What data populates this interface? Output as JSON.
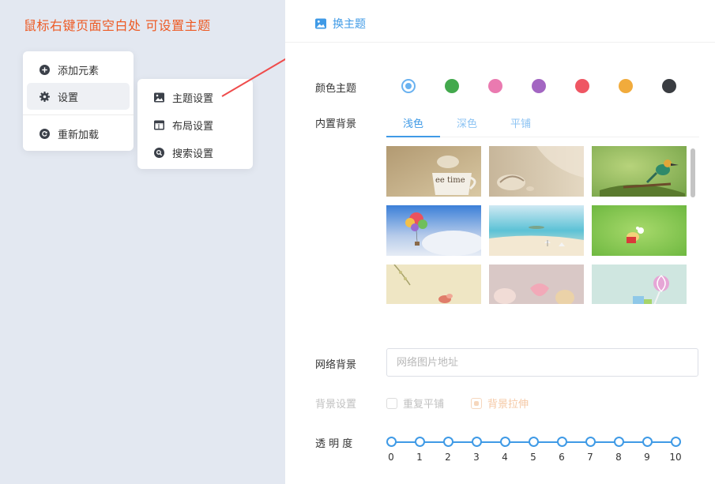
{
  "hint": "鼠标右键页面空白处 可设置主题",
  "context_menu": {
    "items": [
      {
        "label": "添加元素",
        "icon": "plus-circle-icon"
      },
      {
        "label": "设置",
        "icon": "gear-icon"
      },
      {
        "label": "重新加载",
        "icon": "reload-icon"
      }
    ]
  },
  "settings_submenu": {
    "items": [
      {
        "label": "主题设置",
        "icon": "image-icon"
      },
      {
        "label": "布局设置",
        "icon": "layout-icon"
      },
      {
        "label": "搜索设置",
        "icon": "search-icon"
      }
    ]
  },
  "panel": {
    "title": "换主题",
    "color_theme_label": "颜色主题",
    "colors": [
      "#6ab2f0",
      "#43a94d",
      "#ea7ab0",
      "#a366c2",
      "#ef5663",
      "#f1ab3c",
      "#3a3d42"
    ],
    "selected_color": "#6ab2f0",
    "builtin_bg_label": "内置背景",
    "tabs": [
      "浅色",
      "深色",
      "平铺"
    ],
    "active_tab": "浅色",
    "network_bg_label": "网络背景",
    "network_bg_placeholder": "网络图片地址",
    "network_bg_value": "",
    "bg_setting_label": "背景设置",
    "bg_options": [
      "重复平铺",
      "背景拉伸"
    ],
    "transparency_label": "透 明 度",
    "transparency_ticks": [
      "0",
      "1",
      "2",
      "3",
      "4",
      "5",
      "6",
      "7",
      "8",
      "9",
      "10"
    ],
    "thumb_text": "ee time"
  }
}
